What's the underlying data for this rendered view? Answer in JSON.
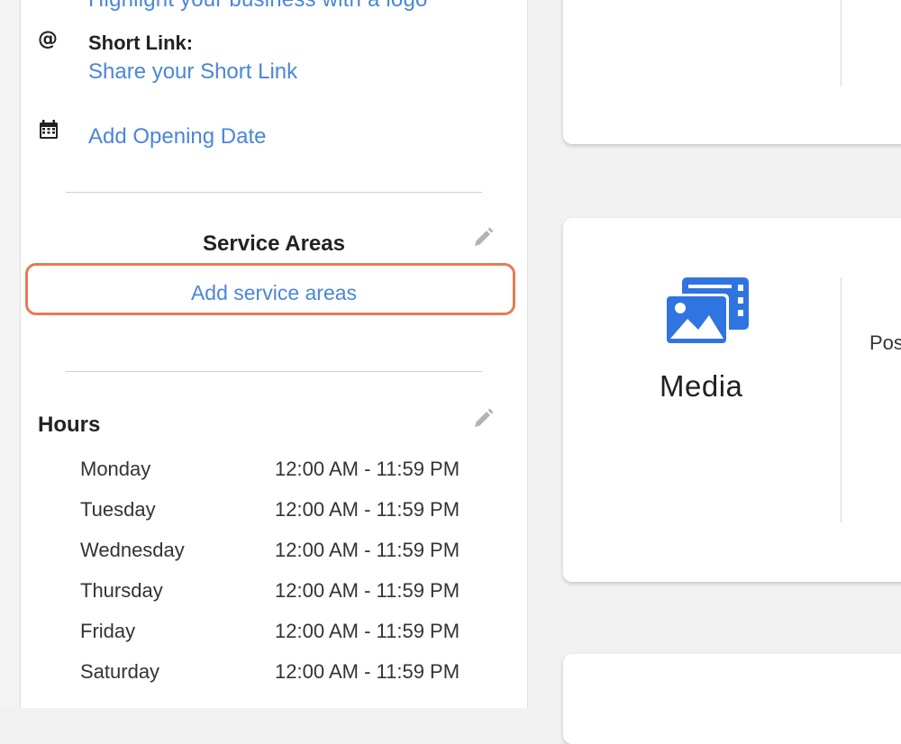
{
  "info_panel": {
    "top_link_partial": "Highlight your business with a logo",
    "short_link": {
      "icon": "at-icon",
      "label": "Short Link:",
      "link_text": "Share your Short Link"
    },
    "opening_date": {
      "icon": "calendar-icon",
      "link_text": "Add Opening Date"
    },
    "service_areas": {
      "title": "Service Areas",
      "edit_icon": "pencil-icon",
      "add_link": "Add service areas",
      "highlight_color": "#e67b52"
    },
    "hours": {
      "title": "Hours",
      "edit_icon": "pencil-icon",
      "rows": [
        {
          "day": "Monday",
          "time": "12:00 AM - 11:59 PM"
        },
        {
          "day": "Tuesday",
          "time": "12:00 AM - 11:59 PM"
        },
        {
          "day": "Wednesday",
          "time": "12:00 AM - 11:59 PM"
        },
        {
          "day": "Thursday",
          "time": "12:00 AM - 11:59 PM"
        },
        {
          "day": "Friday",
          "time": "12:00 AM - 11:59 PM"
        },
        {
          "day": "Saturday",
          "time": "12:00 AM - 11:59 PM"
        }
      ]
    }
  },
  "media_card": {
    "icon": "media-icon",
    "label": "Media",
    "side_text_partial": "Pos"
  },
  "colors": {
    "link": "#4a86d8",
    "media_icon": "#2f74e0"
  }
}
